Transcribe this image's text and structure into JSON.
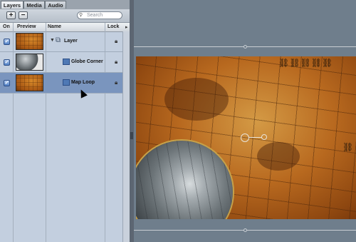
{
  "tabs": [
    {
      "label": "Layers",
      "active": true
    },
    {
      "label": "Media",
      "active": false
    },
    {
      "label": "Audio",
      "active": false
    }
  ],
  "toolbar": {
    "add_label": "+",
    "remove_label": "−",
    "search_placeholder": "Search"
  },
  "columns": {
    "on": "On",
    "preview": "Preview",
    "name": "Name",
    "lock": "Lock"
  },
  "layers": [
    {
      "name": "Layer",
      "on": true,
      "locked": false,
      "thumbnail": "map",
      "type": "group",
      "expanded": true
    },
    {
      "name": "Globe Corner",
      "on": true,
      "locked": false,
      "thumbnail": "globe",
      "type": "clip"
    },
    {
      "name": "Map Loop",
      "on": true,
      "locked": false,
      "thumbnail": "map",
      "type": "clip",
      "selected": true
    }
  ],
  "icons": {
    "check": "checkmark",
    "lock": "lock-icon",
    "disclosure": "disclosure-triangle-icon",
    "group": "layer-stack-icon",
    "clip": "film-clip-icon"
  },
  "colors": {
    "selection": "#7a95be",
    "panel": "#c3cfdf",
    "canvas": "#6f7e8c"
  }
}
